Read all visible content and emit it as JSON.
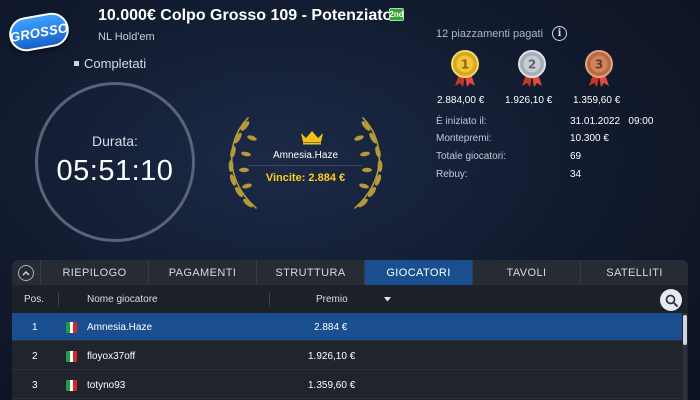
{
  "header": {
    "logo_text": "GROSSO",
    "title": "10.000€ Colpo Grosso 109 - Potenziato",
    "title_badge": "2nd",
    "variant": "NL Hold'em",
    "status": "Completati"
  },
  "timer": {
    "label": "Durata:",
    "value": "05:51:10"
  },
  "winner": {
    "name": "Amnesia.Haze",
    "prize": "Vincite: 2.884 €"
  },
  "payouts": {
    "label": "12 piazzamenti pagati",
    "medals": [
      {
        "place": "1",
        "value": "2.884,00 €",
        "color": "#d8a722"
      },
      {
        "place": "2",
        "value": "1.926,10 €",
        "color": "#a7adb7"
      },
      {
        "place": "3",
        "value": "1.359,60 €",
        "color": "#b86a45"
      }
    ]
  },
  "details": [
    {
      "label": "È iniziato il:",
      "value": "31.01.2022   09:00"
    },
    {
      "label": "Montepremi:",
      "value": "10.300 €"
    },
    {
      "label": "Totale giocatori:",
      "value": "69"
    },
    {
      "label": "Rebuy:",
      "value": "34"
    }
  ],
  "tabs": [
    "RIEPILOGO",
    "PAGAMENTI",
    "STRUTTURA",
    "GIOCATORI",
    "TAVOLI",
    "SATELLITI"
  ],
  "active_tab": "GIOCATORI",
  "table": {
    "headers": {
      "pos": "Pos.",
      "name": "Nome giocatore",
      "prize": "Premio"
    },
    "rows": [
      {
        "pos": "1",
        "name": "Amnesia.Haze",
        "prize": "2.884 €"
      },
      {
        "pos": "2",
        "name": "floyox37off",
        "prize": "1.926,10 €"
      },
      {
        "pos": "3",
        "name": "totyno93",
        "prize": "1.359,60 €"
      }
    ]
  },
  "colors": {
    "accent_blue": "#1a4f8f",
    "gold": "#ffcc22",
    "wreath": "#b59a3a"
  }
}
